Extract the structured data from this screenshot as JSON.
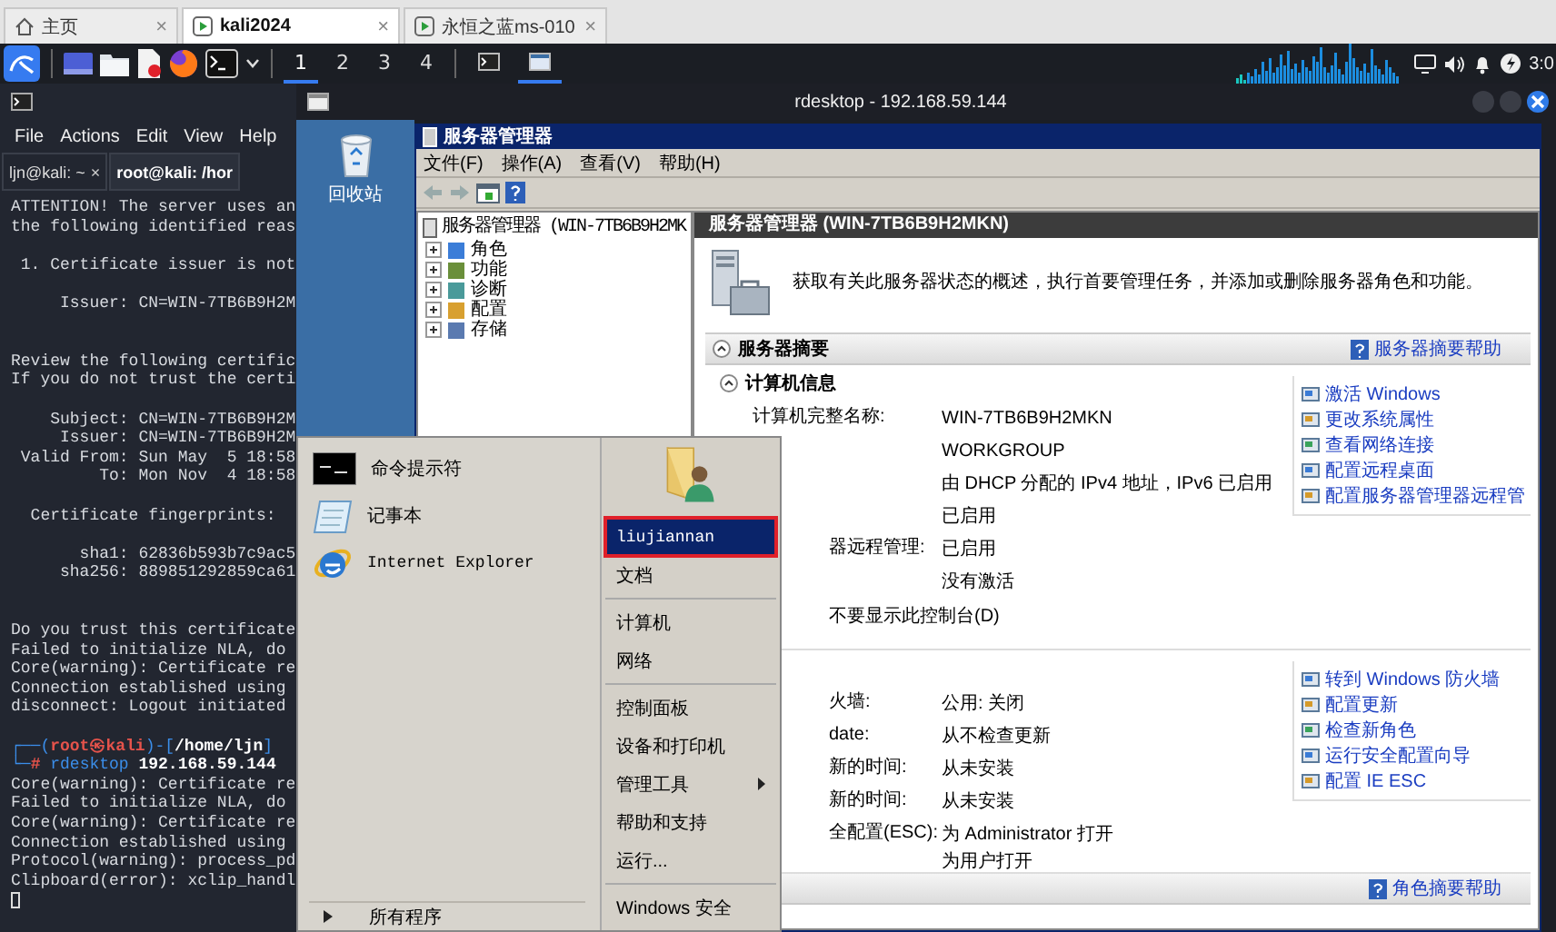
{
  "browser_tabs": [
    {
      "label": "主页",
      "kind": "home",
      "close": "×",
      "selected": false
    },
    {
      "label": "kali2024",
      "kind": "vm",
      "close": "×",
      "selected": true
    },
    {
      "label": "永恒之蓝ms-010",
      "kind": "vm",
      "close": "×",
      "selected": false
    }
  ],
  "taskbar": {
    "workspaces": [
      {
        "label": "1",
        "selected": true
      },
      {
        "label": "2",
        "selected": false
      },
      {
        "label": "3",
        "selected": false
      },
      {
        "label": "4",
        "selected": false
      }
    ],
    "clock": "3:0"
  },
  "terminal": {
    "menu": [
      "File",
      "Actions",
      "Edit",
      "View",
      "Help"
    ],
    "tabs": [
      {
        "label": "ljn@kali: ~",
        "close": "×",
        "selected": false
      },
      {
        "label": "root@kali: /hor",
        "selected": true
      }
    ],
    "lines": [
      {
        "kind": "text",
        "text": "ATTENTION! The server uses an"
      },
      {
        "kind": "text",
        "text": "the following identified reas"
      },
      {
        "kind": "blank"
      },
      {
        "kind": "text",
        "text": " 1. Certificate issuer is not"
      },
      {
        "kind": "blank"
      },
      {
        "kind": "text",
        "text": "     Issuer: CN=WIN-7TB6B9H2M"
      },
      {
        "kind": "blank"
      },
      {
        "kind": "blank"
      },
      {
        "kind": "text",
        "text": "Review the following certific"
      },
      {
        "kind": "text",
        "text": "If you do not trust the certi"
      },
      {
        "kind": "blank"
      },
      {
        "kind": "text",
        "text": "    Subject: CN=WIN-7TB6B9H2M"
      },
      {
        "kind": "text",
        "text": "     Issuer: CN=WIN-7TB6B9H2M"
      },
      {
        "kind": "text",
        "text": " Valid From: Sun May  5 18:58"
      },
      {
        "kind": "text",
        "text": "         To: Mon Nov  4 18:58"
      },
      {
        "kind": "blank"
      },
      {
        "kind": "text",
        "text": "  Certificate fingerprints:"
      },
      {
        "kind": "blank"
      },
      {
        "kind": "text",
        "text": "       sha1: 62836b593b7c9ac5"
      },
      {
        "kind": "text",
        "text": "     sha256: 889851292859ca61"
      },
      {
        "kind": "blank"
      },
      {
        "kind": "blank"
      },
      {
        "kind": "text",
        "text": "Do you trust this certificate"
      },
      {
        "kind": "text",
        "text": "Failed to initialize NLA, do"
      },
      {
        "kind": "text",
        "text": "Core(warning): Certificate re"
      },
      {
        "kind": "text",
        "text": "Connection established using"
      },
      {
        "kind": "text",
        "text": "disconnect: Logout initiated"
      },
      {
        "kind": "blank"
      },
      {
        "kind": "prompt_head",
        "parts": [
          "┌──(",
          "root㉿kali",
          ")-[",
          "/home/ljn",
          "]"
        ]
      },
      {
        "kind": "prompt_cmd",
        "parts": [
          "└─",
          "#",
          " rdesktop",
          " 192.168.59.144"
        ]
      },
      {
        "kind": "text",
        "text": "Core(warning): Certificate re"
      },
      {
        "kind": "text",
        "text": "Failed to initialize NLA, do"
      },
      {
        "kind": "text",
        "text": "Core(warning): Certificate re"
      },
      {
        "kind": "text",
        "text": "Connection established using"
      },
      {
        "kind": "text",
        "text": "Protocol(warning): process_pd"
      },
      {
        "kind": "text",
        "text": "Clipboard(error): xclip_handl"
      },
      {
        "kind": "cursor"
      }
    ]
  },
  "rdesktop": {
    "title": "rdesktop - 192.168.59.144",
    "desktop_icons": [
      {
        "label": "回收站"
      }
    ],
    "server_manager": {
      "title": "服务器管理器",
      "menu": [
        "文件(F)",
        "操作(A)",
        "查看(V)",
        "帮助(H)"
      ],
      "tree": {
        "root": "服务器管理器 (WIN-7TB6B9H2MK",
        "children": [
          {
            "label": "角色",
            "expanded": false
          },
          {
            "label": "功能",
            "expanded": false
          },
          {
            "label": "诊断",
            "expanded": false
          },
          {
            "label": "配置",
            "expanded": false
          },
          {
            "label": "存储",
            "expanded": false
          }
        ]
      },
      "header": "服务器管理器 (WIN-7TB6B9H2MKN)",
      "intro": "获取有关此服务器状态的概述，执行首要管理任务，并添加或删除服务器角色和功能。",
      "sections": [
        {
          "title": "服务器摘要",
          "help": "服务器摘要帮助",
          "subsections": [
            {
              "title": "计算机信息",
              "rows": [
                {
                  "kind": "full",
                  "label": "计算机完整名称:",
                  "values": [
                    "WIN-7TB6B9H2MKN"
                  ]
                },
                {
                  "kind": "full",
                  "values": [
                    "WORKGROUP"
                  ]
                },
                {
                  "kind": "full",
                  "values": [
                    "由 DHCP 分配的 IPv4 地址，IPv6 已启用"
                  ]
                },
                {
                  "kind": "full",
                  "values": [
                    "已启用"
                  ]
                },
                {
                  "kind": "cut",
                  "label": "器远程管理:",
                  "values": [
                    "已启用"
                  ]
                },
                {
                  "kind": "full",
                  "values": [
                    "没有激活"
                  ]
                }
              ],
              "note": "不要显示此控制台(D)",
              "links": [
                "激活 Windows",
                "更改系统属性",
                "查看网络连接",
                "配置远程桌面",
                "配置服务器管理器远程管"
              ]
            },
            {
              "rows": [
                {
                  "kind": "cut",
                  "label": "火墙:",
                  "values": [
                    "公用: 关闭"
                  ]
                },
                {
                  "kind": "cut",
                  "label": "date:",
                  "values": [
                    "从不检查更新"
                  ]
                },
                {
                  "kind": "cut",
                  "label": "新的时间:",
                  "values": [
                    "从未安装"
                  ]
                },
                {
                  "kind": "cut",
                  "label": "新的时间:",
                  "values": [
                    "从未安装"
                  ]
                },
                {
                  "kind": "cut",
                  "label": "全配置(ESC):",
                  "values": [
                    "为 Administrator 打开",
                    "为用户打开"
                  ]
                }
              ],
              "links": [
                "转到 Windows 防火墙",
                "配置更新",
                "检查新角色",
                "运行安全配置向导",
                "配置 IE ESC"
              ]
            }
          ]
        },
        {
          "help": "角色摘要帮助"
        }
      ]
    }
  },
  "start_menu": {
    "programs": [
      {
        "label": "命令提示符",
        "kind": "cmd"
      },
      {
        "label": "记事本",
        "kind": "notepad"
      },
      {
        "label": "Internet Explorer",
        "kind": "ie"
      }
    ],
    "all_programs": "所有程序",
    "place_groups": [
      [
        {
          "label": "liujiannan",
          "selected": true,
          "submenu": false
        },
        {
          "label": "文档",
          "selected": false,
          "submenu": false
        }
      ],
      [
        {
          "label": "计算机",
          "selected": false,
          "submenu": false
        },
        {
          "label": "网络",
          "selected": false,
          "submenu": false
        }
      ],
      [
        {
          "label": "控制面板",
          "selected": false,
          "submenu": false
        },
        {
          "label": "设备和打印机",
          "selected": false,
          "submenu": false
        },
        {
          "label": "管理工具",
          "selected": false,
          "submenu": true
        },
        {
          "label": "帮助和支持",
          "selected": false,
          "submenu": false
        },
        {
          "label": "运行...",
          "selected": false,
          "submenu": false
        }
      ],
      [
        {
          "label": "Windows 安全",
          "selected": false,
          "submenu": false
        }
      ]
    ]
  }
}
